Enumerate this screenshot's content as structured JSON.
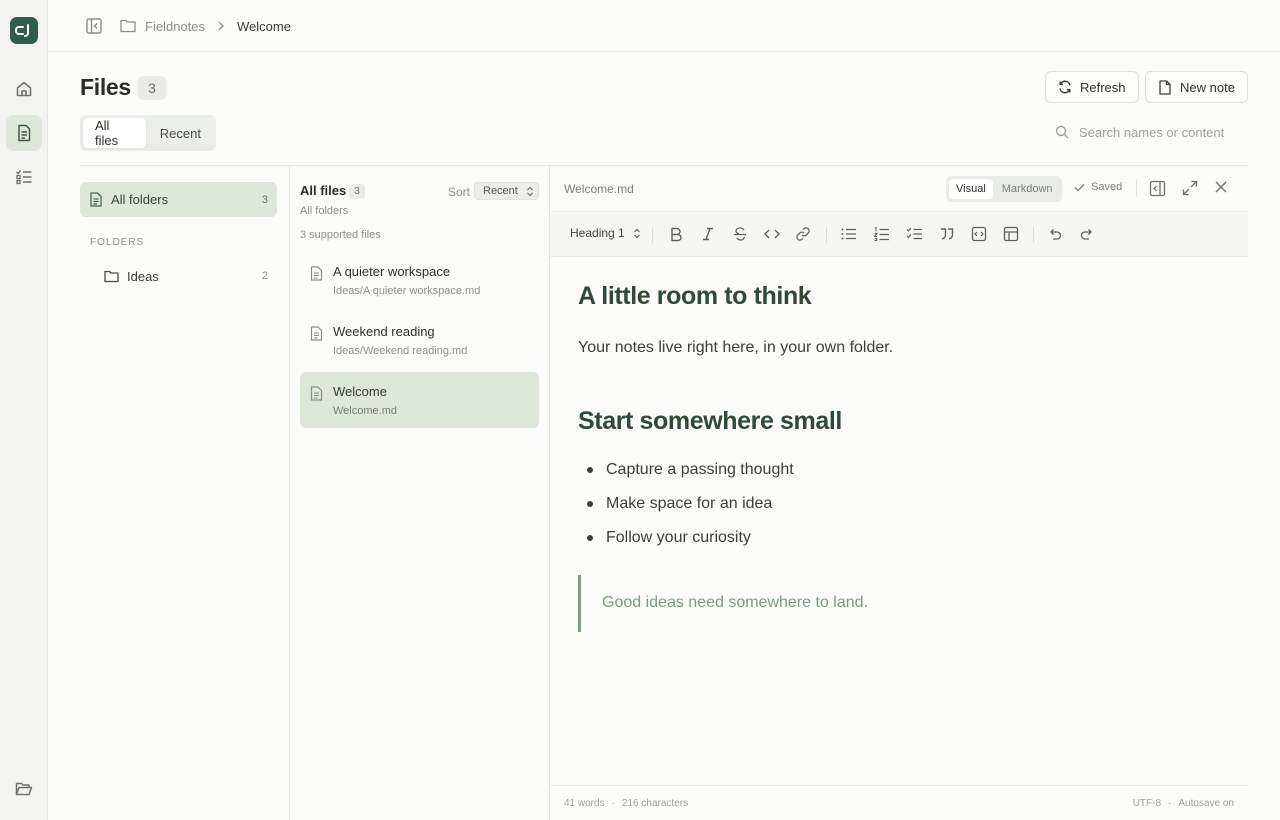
{
  "breadcrumb": {
    "root": "Fieldnotes",
    "current": "Welcome"
  },
  "header": {
    "title": "Files",
    "count": "3",
    "tabs": [
      {
        "label": "All files"
      },
      {
        "label": "Recent"
      }
    ],
    "refresh_label": "Refresh",
    "new_note_label": "New note",
    "search_placeholder": "Search names or content"
  },
  "folders_pane": {
    "all_label": "All folders",
    "all_count": "3",
    "section_label": "FOLDERS",
    "items": [
      {
        "label": "Ideas",
        "count": "2"
      }
    ]
  },
  "files_pane": {
    "title": "All files",
    "count": "3",
    "subtitle": "All folders",
    "sort_label": "Sort",
    "sort_value": "Recent",
    "supported": "3 supported files",
    "files": [
      {
        "name": "A quieter workspace",
        "path": "Ideas/A quieter workspace.md"
      },
      {
        "name": "Weekend reading",
        "path": "Ideas/Weekend reading.md"
      },
      {
        "name": "Welcome",
        "path": "Welcome.md"
      }
    ]
  },
  "editor": {
    "filename": "Welcome.md",
    "modes": [
      {
        "label": "Visual"
      },
      {
        "label": "Markdown"
      }
    ],
    "saved_label": "Saved",
    "block_type": "Heading 1",
    "doc": {
      "h1": "A little room to think",
      "p1": "Your notes live right here, in your own folder.",
      "h2": "Start somewhere small",
      "list": [
        "Capture a passing thought",
        "Make space for an idea",
        "Follow your curiosity"
      ],
      "quote": "Good ideas need somewhere to land."
    },
    "footer": {
      "words": "41 words",
      "chars": "216 characters",
      "encoding": "UTF-8",
      "autosave": "Autosave on"
    }
  },
  "colors": {
    "accent": "#2f5d4a",
    "active_bg": "#dfe7db",
    "heading": "#2f4a36",
    "quote": "#7e9a7d"
  },
  "icons": {
    "rail": [
      "home-icon",
      "file-text-icon",
      "checklist-icon",
      "folder-open-icon"
    ],
    "toolbar": [
      "bold-icon",
      "italic-icon",
      "strikethrough-icon",
      "code-icon",
      "link-icon",
      "bullet-list-icon",
      "numbered-list-icon",
      "task-list-icon",
      "quote-icon",
      "code-block-icon",
      "table-icon",
      "undo-icon",
      "redo-icon"
    ]
  }
}
